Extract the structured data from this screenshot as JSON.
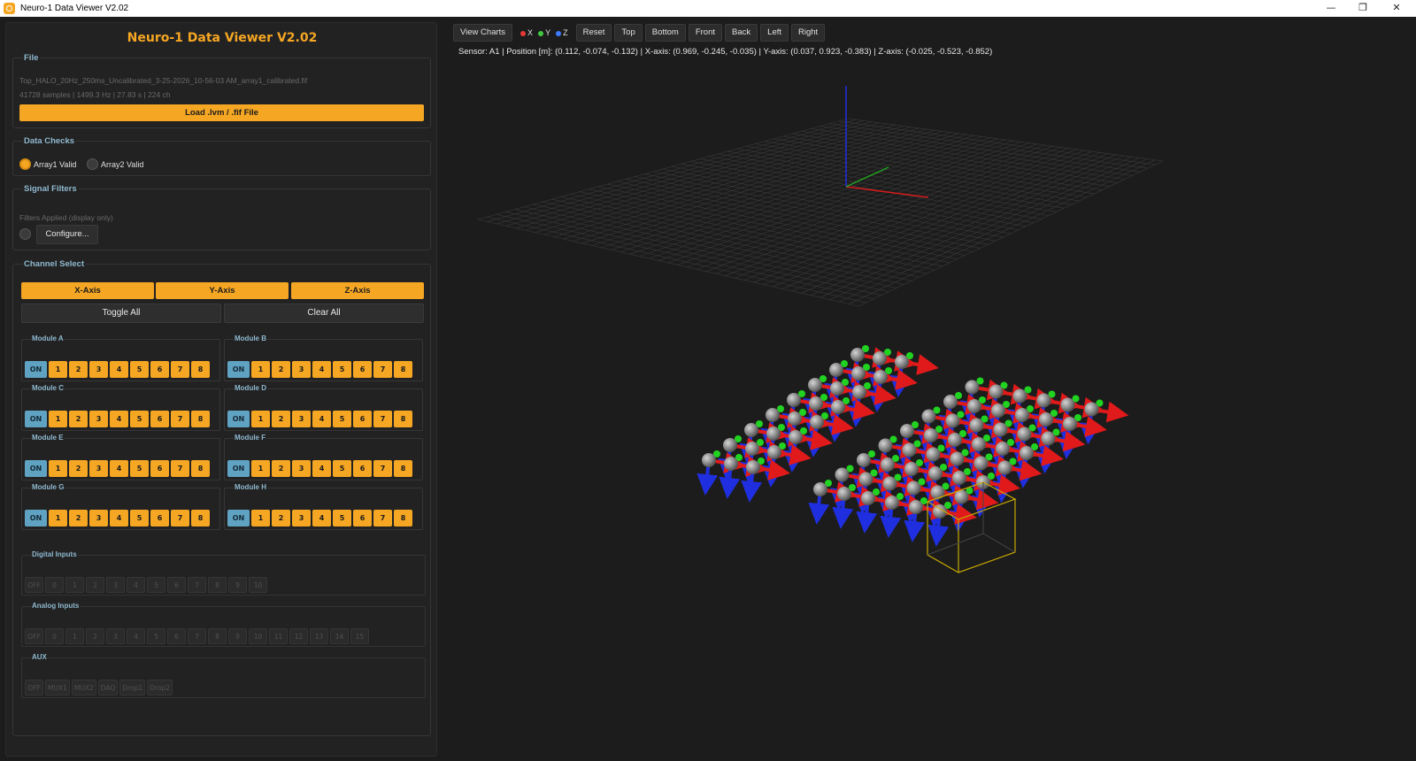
{
  "window": {
    "title": "Neuro-1 Data Viewer  V2.02",
    "controls": [
      "—",
      "❐",
      "✕"
    ]
  },
  "left": {
    "app_title": "Neuro-1 Data Viewer  V2.02",
    "file": {
      "title": "File",
      "filename": "Top_HALO_20Hz_250ms_Uncalibrated_3-25-2026_10-56-03 AM_array1_calibrated.fif",
      "info": "41728 samples  |  1499.3 Hz  |  27.83 s  |  224 ch",
      "load_label": "Load .lvm / .fif File"
    },
    "data_checks": {
      "title": "Data Checks",
      "array1": "Array1 Valid",
      "array2": "Array2 Valid"
    },
    "signal_filters": {
      "title": "Signal Filters",
      "note": "Filters Applied (display only)",
      "configure": "Configure..."
    },
    "channel_select": {
      "title": "Channel Select",
      "x_axis": "X-Axis",
      "y_axis": "Y-Axis",
      "z_axis": "Z-Axis",
      "toggle_all": "Toggle All",
      "clear_all": "Clear All",
      "modules": [
        {
          "name": "Module A",
          "on": "ON",
          "channels": [
            "1",
            "2",
            "3",
            "4",
            "5",
            "6",
            "7",
            "8"
          ]
        },
        {
          "name": "Module B",
          "on": "ON",
          "channels": [
            "1",
            "2",
            "3",
            "4",
            "5",
            "6",
            "7",
            "8"
          ]
        },
        {
          "name": "Module C",
          "on": "ON",
          "channels": [
            "1",
            "2",
            "3",
            "4",
            "5",
            "6",
            "7",
            "8"
          ]
        },
        {
          "name": "Module D",
          "on": "ON",
          "channels": [
            "1",
            "2",
            "3",
            "4",
            "5",
            "6",
            "7",
            "8"
          ]
        },
        {
          "name": "Module E",
          "on": "ON",
          "channels": [
            "1",
            "2",
            "3",
            "4",
            "5",
            "6",
            "7",
            "8"
          ]
        },
        {
          "name": "Module F",
          "on": "ON",
          "channels": [
            "1",
            "2",
            "3",
            "4",
            "5",
            "6",
            "7",
            "8"
          ]
        },
        {
          "name": "Module G",
          "on": "ON",
          "channels": [
            "1",
            "2",
            "3",
            "4",
            "5",
            "6",
            "7",
            "8"
          ]
        },
        {
          "name": "Module H",
          "on": "ON",
          "channels": [
            "1",
            "2",
            "3",
            "4",
            "5",
            "6",
            "7",
            "8"
          ]
        }
      ],
      "digital_inputs": {
        "title": "Digital Inputs",
        "buttons": [
          "OFF",
          "0",
          "1",
          "2",
          "3",
          "4",
          "5",
          "6",
          "7",
          "8",
          "9",
          "10"
        ]
      },
      "analog_inputs": {
        "title": "Analog Inputs",
        "buttons": [
          "OFF",
          "0",
          "1",
          "2",
          "3",
          "4",
          "5",
          "6",
          "7",
          "8",
          "9",
          "10",
          "11",
          "12",
          "13",
          "14",
          "15"
        ]
      },
      "aux": {
        "title": "AUX",
        "buttons": [
          "OFF",
          "MUX1",
          "MUX2",
          "DAQ",
          "Drop1",
          "Drop2"
        ]
      }
    }
  },
  "toolbar": {
    "view_charts": "View Charts",
    "legend": [
      {
        "label": "X",
        "color": "#e53935"
      },
      {
        "label": "Y",
        "color": "#43c743"
      },
      {
        "label": "Z",
        "color": "#3d7bff"
      }
    ],
    "views": [
      "Reset",
      "Top",
      "Bottom",
      "Front",
      "Back",
      "Left",
      "Right"
    ]
  },
  "status": "Sensor: A1  |  Position [m]: (0.112, -0.074, -0.132)  |  X-axis: (0.969, -0.245, -0.035)  |  Y-axis: (0.037, 0.923, -0.383)  |  Z-axis: (-0.025, -0.523, -0.852)",
  "scene": {
    "sensor_count": 64,
    "selected_sensor": "A1",
    "colors": {
      "x": "#e01a1a",
      "y": "#21d321",
      "z": "#1f2fe0",
      "sensor": "#9a9a9a",
      "selection": "#c8a800",
      "grid": "#3a3a3a"
    }
  }
}
